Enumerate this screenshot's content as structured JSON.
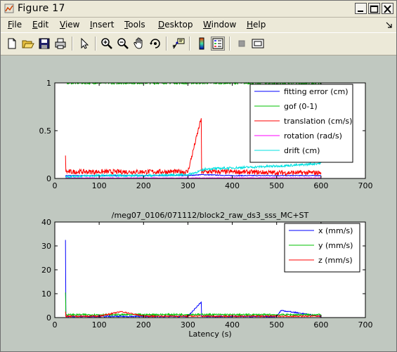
{
  "window": {
    "title": "Figure 17"
  },
  "menu": {
    "items": [
      {
        "u": "F",
        "rest": "ile"
      },
      {
        "u": "E",
        "rest": "dit"
      },
      {
        "u": "V",
        "rest": "iew"
      },
      {
        "u": "I",
        "rest": "nsert"
      },
      {
        "u": "T",
        "rest": "ools"
      },
      {
        "u": "D",
        "rest": "esktop"
      },
      {
        "u": "W",
        "rest": "indow"
      },
      {
        "u": "H",
        "rest": "elp"
      }
    ]
  },
  "toolbar": {
    "buttons": [
      "new-file",
      "open-folder",
      "save",
      "print",
      "select-arrow",
      "zoom-in",
      "zoom-out",
      "pan-hand",
      "rotate-3d",
      "data-cursor",
      "colorbar",
      "legend",
      "hide-plot-tools",
      "show-plot-tools"
    ]
  },
  "chart_data": [
    {
      "type": "line",
      "title": "",
      "xlabel": "",
      "ylabel": "",
      "xlim": [
        0,
        700
      ],
      "ylim": [
        0,
        1
      ],
      "xticks": [
        "0",
        "100",
        "200",
        "300",
        "400",
        "500",
        "600",
        "700"
      ],
      "yticks": [
        "0",
        "0.5",
        "1"
      ],
      "legend_position": "top-right",
      "series": [
        {
          "name": "fitting error (cm)",
          "color": "#0000ff",
          "x": [
            24,
            100,
            200,
            300,
            330,
            400,
            500,
            600
          ],
          "y": [
            0.03,
            0.03,
            0.03,
            0.03,
            0.04,
            0.03,
            0.03,
            0.03
          ]
        },
        {
          "name": "gof (0-1)",
          "color": "#00c000",
          "x": [
            24,
            100,
            200,
            300,
            400,
            500,
            600
          ],
          "y": [
            1.0,
            1.0,
            1.0,
            1.0,
            1.0,
            1.0,
            1.0
          ]
        },
        {
          "name": "translation (cm/s)",
          "color": "#ff0000",
          "x": [
            24,
            25,
            100,
            200,
            300,
            330,
            331,
            332,
            400,
            500,
            600
          ],
          "y": [
            0.24,
            0.07,
            0.07,
            0.07,
            0.07,
            0.63,
            0.05,
            0.07,
            0.07,
            0.06,
            0.06
          ]
        },
        {
          "name": "rotation (rad/s)",
          "color": "#ff00ff",
          "x": [
            24,
            100,
            200,
            300,
            400,
            500,
            600
          ],
          "y": [
            0.005,
            0.005,
            0.005,
            0.005,
            0.005,
            0.005,
            0.005
          ]
        },
        {
          "name": "drift (cm)",
          "color": "#00e0e0",
          "x": [
            24,
            100,
            200,
            300,
            330,
            340,
            400,
            450,
            500,
            550,
            600
          ],
          "y": [
            0.02,
            0.03,
            0.03,
            0.04,
            0.08,
            0.1,
            0.11,
            0.12,
            0.13,
            0.14,
            0.16
          ]
        }
      ]
    },
    {
      "type": "line",
      "title": "/meg07_0106/071112/block2_raw_ds3_sss_MC+ST",
      "xlabel": "Latency (s)",
      "ylabel": "",
      "xlim": [
        0,
        700
      ],
      "ylim": [
        0,
        40
      ],
      "xticks": [
        "0",
        "100",
        "200",
        "300",
        "400",
        "500",
        "600",
        "700"
      ],
      "yticks": [
        "0",
        "10",
        "20",
        "30",
        "40"
      ],
      "legend_position": "top-right",
      "series": [
        {
          "name": "x (mm/s)",
          "color": "#0000ff",
          "x": [
            24,
            25,
            100,
            200,
            300,
            330,
            331,
            400,
            500,
            510,
            600
          ],
          "y": [
            32.5,
            0.5,
            0.5,
            0.5,
            0.5,
            6.5,
            0.5,
            0.5,
            0.5,
            3.0,
            0.5
          ]
        },
        {
          "name": "y (mm/s)",
          "color": "#00c000",
          "x": [
            24,
            25,
            100,
            200,
            300,
            400,
            500,
            600
          ],
          "y": [
            10.5,
            1.2,
            1.2,
            1.2,
            1.3,
            1.2,
            1.2,
            1.2
          ]
        },
        {
          "name": "z (mm/s)",
          "color": "#ff0000",
          "x": [
            24,
            25,
            100,
            150,
            200,
            300,
            400,
            500,
            600
          ],
          "y": [
            2.5,
            0.5,
            0.6,
            2.5,
            0.6,
            0.6,
            0.6,
            0.6,
            0.6
          ]
        }
      ]
    }
  ]
}
